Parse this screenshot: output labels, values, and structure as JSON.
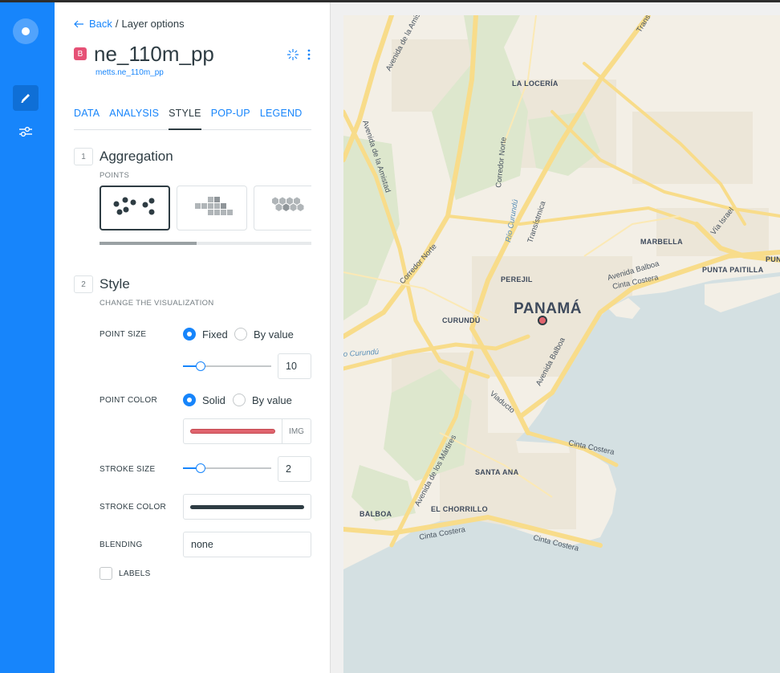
{
  "nav": {
    "logo_icon": "carto-logo-icon",
    "edit_icon": "pencil-icon",
    "settings_icon": "sliders-icon",
    "accent": "#1785fb"
  },
  "breadcrumb": {
    "back_label": "Back",
    "separator": "/",
    "current": "Layer options"
  },
  "layer": {
    "badge": "B",
    "badge_color": "#e65176",
    "name": "ne_110m_pp",
    "source": "metts.ne_110m_pp"
  },
  "tabs": [
    {
      "label": "DATA",
      "active": false
    },
    {
      "label": "ANALYSIS",
      "active": false
    },
    {
      "label": "STYLE",
      "active": true
    },
    {
      "label": "POP-UP",
      "active": false
    },
    {
      "label": "LEGEND",
      "active": false
    }
  ],
  "aggregation": {
    "number": "1",
    "title": "Aggregation",
    "subtitle": "POINTS",
    "options": [
      "points",
      "squares",
      "hexabins"
    ],
    "selected": "points"
  },
  "style": {
    "number": "2",
    "title": "Style",
    "subtitle": "CHANGE THE VISUALIZATION",
    "point_size": {
      "label": "POINT SIZE",
      "option_fixed": "Fixed",
      "option_by_value": "By value",
      "selected": "Fixed",
      "value": "10",
      "slider_fraction": 0.2
    },
    "point_color": {
      "label": "POINT COLOR",
      "option_solid": "Solid",
      "option_by_value": "By value",
      "selected": "Solid",
      "color": "#e0646e",
      "img_label": "IMG"
    },
    "stroke_size": {
      "label": "STROKE SIZE",
      "value": "2",
      "slider_fraction": 0.2
    },
    "stroke_color": {
      "label": "STROKE COLOR",
      "color": "#2e3c43"
    },
    "blending": {
      "label": "BLENDING",
      "value": "none"
    },
    "labels": {
      "label": "LABELS",
      "checked": false
    }
  },
  "map": {
    "city_label": "PANAMÁ",
    "point_color": "#e0646e",
    "place_labels": [
      "LA LOCERÍA",
      "MARBELLA",
      "PUNTA PAITILLA",
      "PUN",
      "PEREJIL",
      "CURUNDÚ",
      "SANTA ANA",
      "BALBOA",
      "EL CHORRILLO"
    ],
    "road_labels": [
      "Avenida de la Amistad",
      "Avenida de la Amistad",
      "Corredor Norte",
      "Corredor Norte",
      "Transístmica",
      "Río Curundú",
      "o Curundú",
      "Vía Israel",
      "Avenida Balboa",
      "Cinta Costera",
      "Avenida Balboa",
      "Viaducto",
      "Cinta Costera",
      "Avenida de los Mártires",
      "Cinta Costera",
      "Cinta Costera",
      "Trans"
    ]
  }
}
